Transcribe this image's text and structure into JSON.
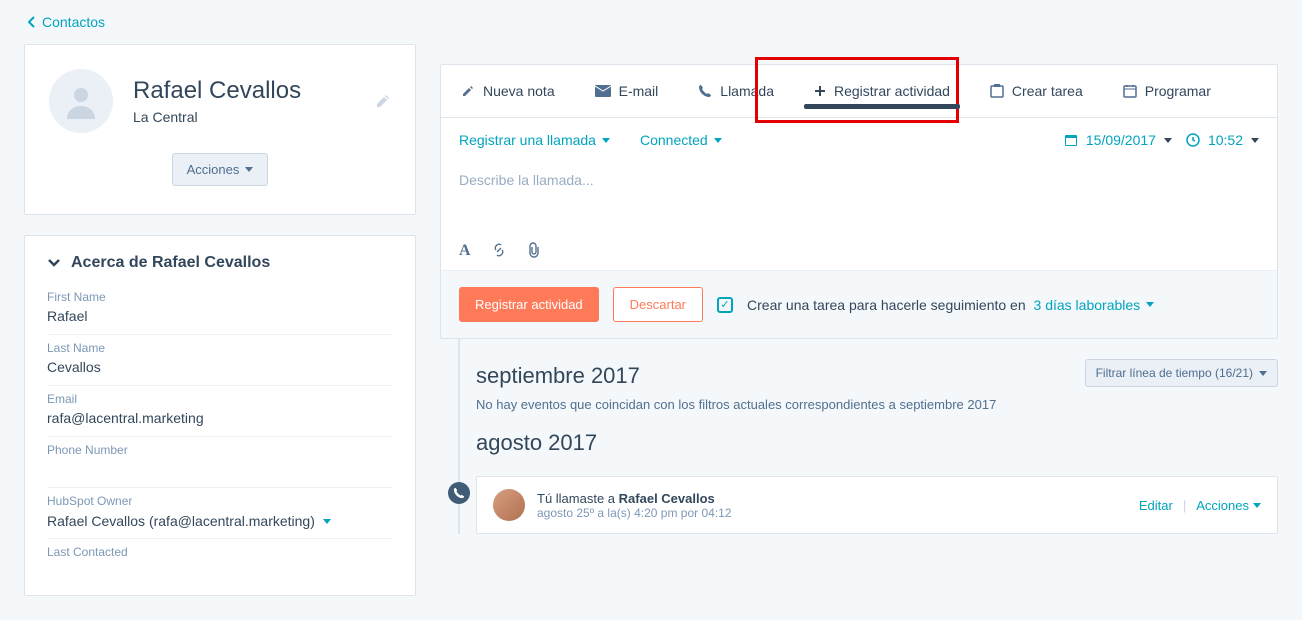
{
  "nav": {
    "back": "Contactos"
  },
  "contact": {
    "name": "Rafael Cevallos",
    "company": "La Central",
    "actions_label": "Acciones"
  },
  "about": {
    "header": "Acerca de Rafael Cevallos",
    "fields": {
      "first_name_label": "First Name",
      "first_name": "Rafael",
      "last_name_label": "Last Name",
      "last_name": "Cevallos",
      "email_label": "Email",
      "email": "rafa@lacentral.marketing",
      "phone_label": "Phone Number",
      "phone": "",
      "owner_label": "HubSpot Owner",
      "owner": "Rafael Cevallos (rafa@lacentral.marketing)",
      "last_contacted_label": "Last Contacted"
    }
  },
  "tabs": {
    "note": "Nueva nota",
    "email": "E-mail",
    "call": "Llamada",
    "log": "Registrar actividad",
    "task": "Crear tarea",
    "schedule": "Programar"
  },
  "log": {
    "type": "Registrar una llamada",
    "status": "Connected",
    "date": "15/09/2017",
    "time": "10:52",
    "placeholder": "Describe la llamada..."
  },
  "actions": {
    "register": "Registrar actividad",
    "discard": "Descartar",
    "create_task": "Crear una tarea para hacerle seguimiento en",
    "task_days": "3 días laborables"
  },
  "timeline": {
    "month1": "septiembre 2017",
    "filter": "Filtrar línea de tiempo (16/21)",
    "empty": "No hay eventos que coincidan con los filtros actuales correspondientes a septiembre 2017",
    "month2": "agosto 2017",
    "call": {
      "you_called": "Tú llamaste a ",
      "who": "Rafael Cevallos",
      "meta": "agosto 25º a la(s) 4:20 pm por 04:12",
      "edit": "Editar",
      "actions": "Acciones"
    }
  }
}
